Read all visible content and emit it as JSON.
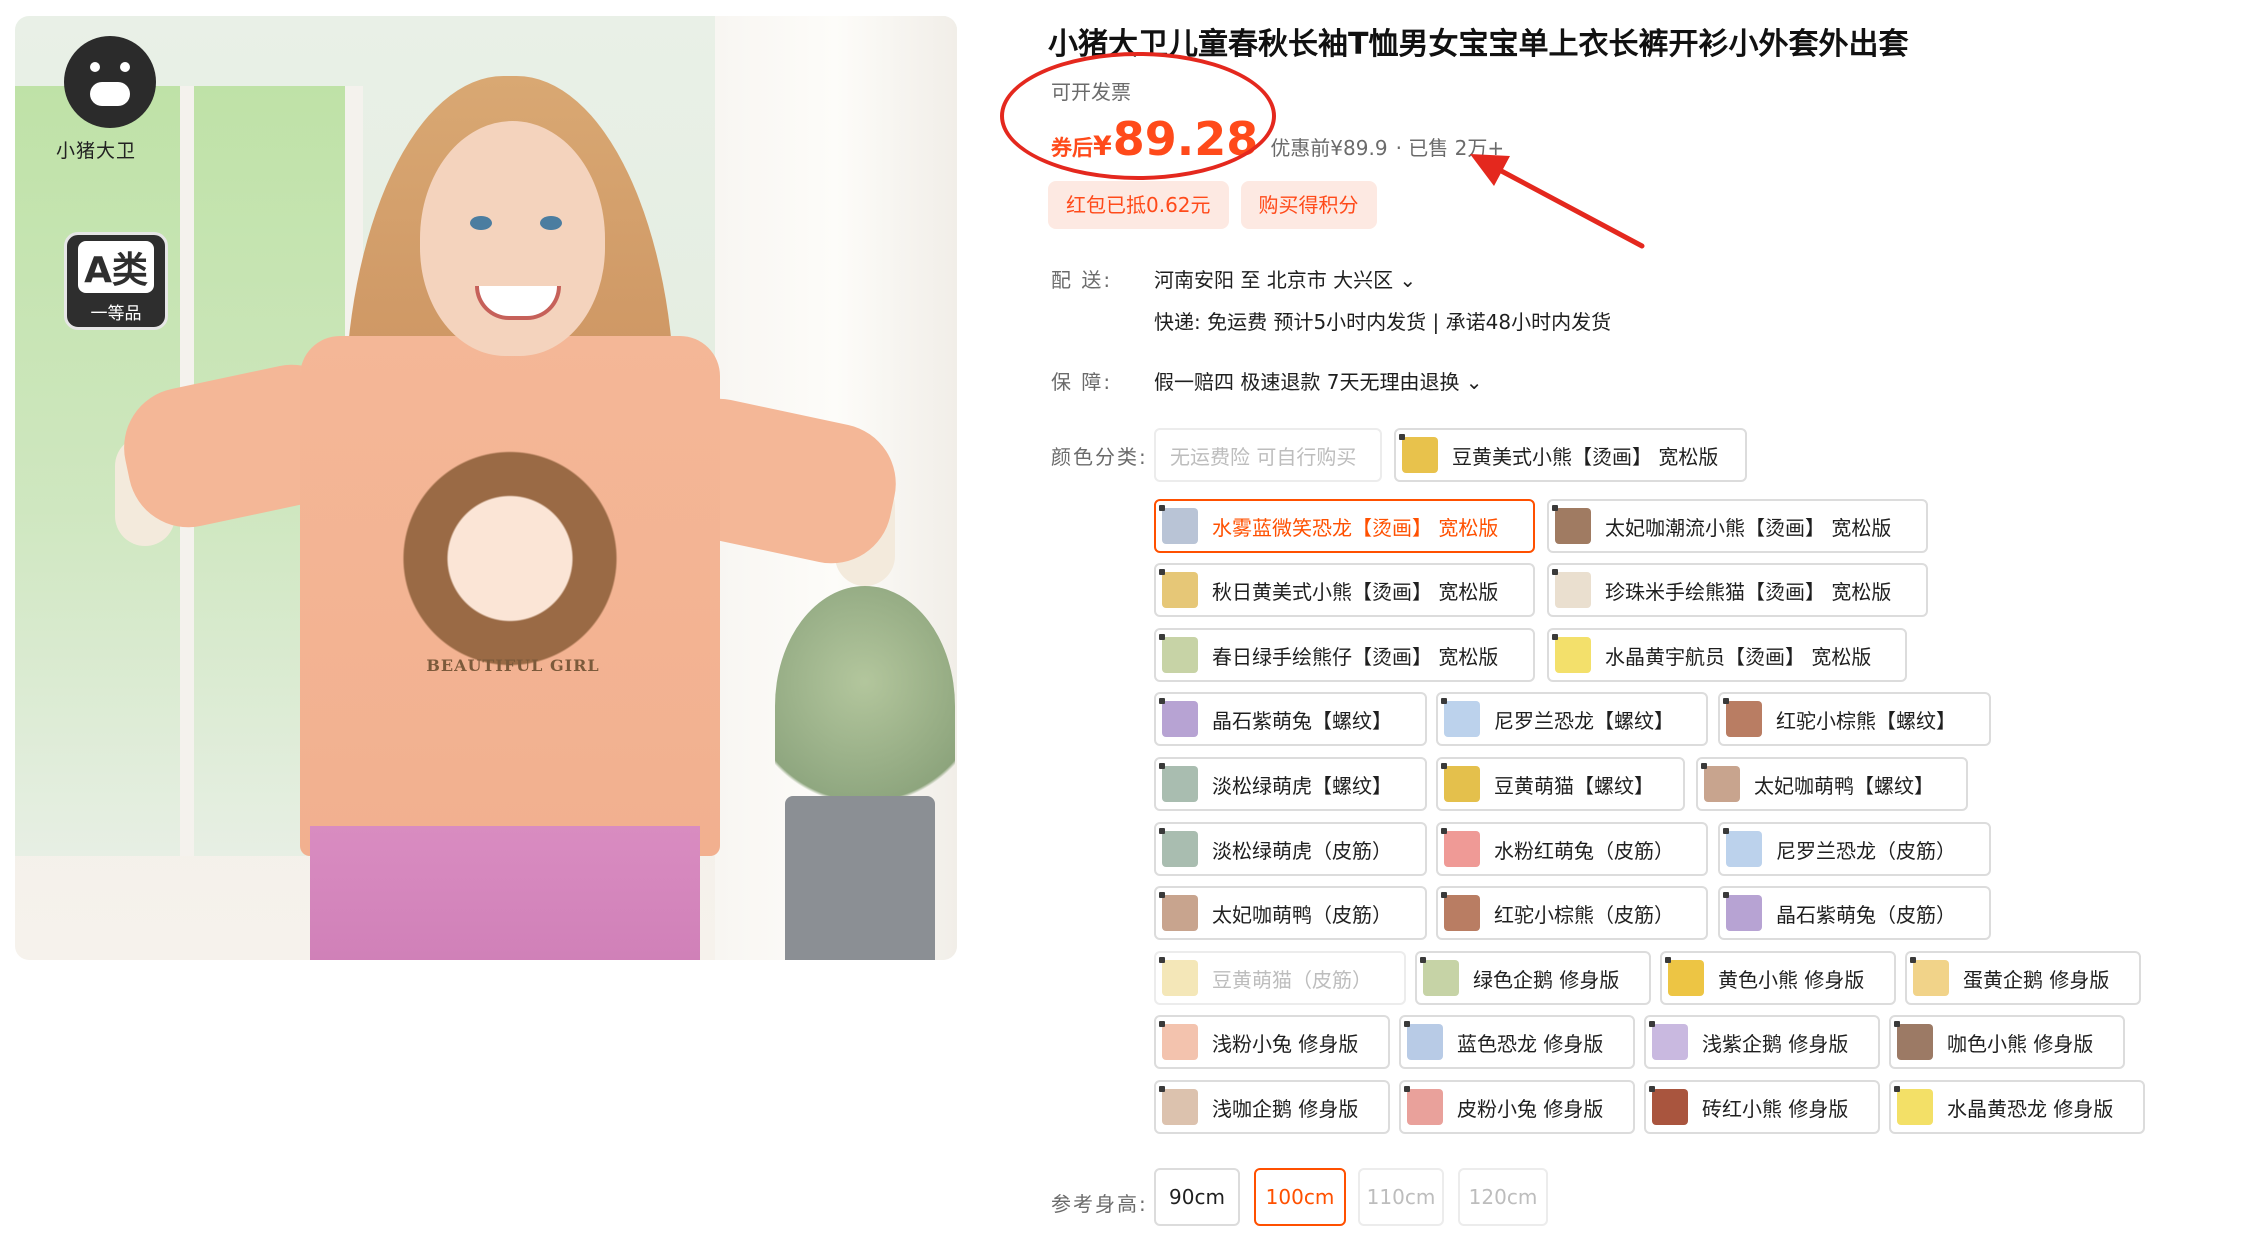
{
  "product": {
    "title": "小猪大卫儿童春秋长袖T恤男女宝宝单上衣长裤开衫小外套外出套",
    "invoice": "可开发票",
    "price_prefix": "券后",
    "currency": "¥",
    "price": "89.28",
    "original_price": "优惠前¥89.9",
    "sold": "· 已售 2万+"
  },
  "image": {
    "brand": "小猪大卫",
    "badge_main": "A类",
    "badge_sub": "一等品",
    "print_text": "BEAUTIFUL GIRL"
  },
  "promo_tags": [
    "红包已抵0.62元",
    "购买得积分"
  ],
  "shipping": {
    "label": "配    送:",
    "from": "河南安阳  至  北京市 大兴区 ⌄",
    "note": "快递: 免运费   预计5小时内发货 | 承诺48小时内发货"
  },
  "guarantee": {
    "label": "保    障:",
    "text": "假一赔四  极速退款  7天无理由退换 ⌄"
  },
  "color": {
    "label": "颜色分类:",
    "options": [
      {
        "text": "无运费险 可自行购买",
        "state": "disabled",
        "swatch": ""
      },
      {
        "text": "豆黄美式小熊【烫画】 宽松版",
        "state": "normal",
        "swatch": "#e8c24c"
      },
      {
        "text": "水雾蓝微笑恐龙【烫画】 宽松版",
        "state": "selected",
        "swatch": "#b9c4d6"
      },
      {
        "text": "太妃咖潮流小熊【烫画】 宽松版",
        "state": "normal",
        "swatch": "#a07b62"
      },
      {
        "text": "秋日黄美式小熊【烫画】 宽松版",
        "state": "normal",
        "swatch": "#e6c777"
      },
      {
        "text": "珍珠米手绘熊猫【烫画】 宽松版",
        "state": "normal",
        "swatch": "#eadfcf"
      },
      {
        "text": "春日绿手绘熊仔【烫画】 宽松版",
        "state": "normal",
        "swatch": "#c7d3a6"
      },
      {
        "text": "水晶黄宇航员【烫画】 宽松版",
        "state": "normal",
        "swatch": "#f3e06b"
      },
      {
        "text": "晶石紫萌兔【螺纹】",
        "state": "normal",
        "swatch": "#b7a3d3"
      },
      {
        "text": "尼罗兰恐龙【螺纹】",
        "state": "normal",
        "swatch": "#bcd2ec"
      },
      {
        "text": "红驼小棕熊【螺纹】",
        "state": "normal",
        "swatch": "#b97d63"
      },
      {
        "text": "淡松绿萌虎【螺纹】",
        "state": "normal",
        "swatch": "#a9bdb0"
      },
      {
        "text": "豆黄萌猫【螺纹】",
        "state": "normal",
        "swatch": "#e4c04c"
      },
      {
        "text": "太妃咖萌鸭【螺纹】",
        "state": "normal",
        "swatch": "#c8a48e"
      },
      {
        "text": "淡松绿萌虎（皮筋）",
        "state": "normal",
        "swatch": "#a9bdb0"
      },
      {
        "text": "水粉红萌兔（皮筋）",
        "state": "normal",
        "swatch": "#ef9a96"
      },
      {
        "text": "尼罗兰恐龙（皮筋）",
        "state": "normal",
        "swatch": "#bcd2ec"
      },
      {
        "text": "太妃咖萌鸭（皮筋）",
        "state": "normal",
        "swatch": "#c8a48e"
      },
      {
        "text": "红驼小棕熊（皮筋）",
        "state": "normal",
        "swatch": "#b97d63"
      },
      {
        "text": "晶石紫萌兔（皮筋）",
        "state": "normal",
        "swatch": "#b7a3d3"
      },
      {
        "text": "豆黄萌猫（皮筋）",
        "state": "disabled",
        "swatch": "#f4e7b8"
      },
      {
        "text": "绿色企鹅 修身版",
        "state": "normal",
        "swatch": "#c6d3a6"
      },
      {
        "text": "黄色小熊 修身版",
        "state": "normal",
        "swatch": "#edc544"
      },
      {
        "text": "蛋黄企鹅 修身版",
        "state": "normal",
        "swatch": "#f1d389"
      },
      {
        "text": "浅粉小兔 修身版",
        "state": "normal",
        "swatch": "#f3c3ae"
      },
      {
        "text": "蓝色恐龙 修身版",
        "state": "normal",
        "swatch": "#b8cbe6"
      },
      {
        "text": "浅紫企鹅 修身版",
        "state": "normal",
        "swatch": "#c9b9e0"
      },
      {
        "text": "咖色小熊 修身版",
        "state": "normal",
        "swatch": "#9c7a65"
      },
      {
        "text": "浅咖企鹅 修身版",
        "state": "normal",
        "swatch": "#dcc2ae"
      },
      {
        "text": "皮粉小兔 修身版",
        "state": "normal",
        "swatch": "#e9a19b"
      },
      {
        "text": "砖红小熊 修身版",
        "state": "normal",
        "swatch": "#a9553e"
      },
      {
        "text": "水晶黄恐龙 修身版",
        "state": "normal",
        "swatch": "#f3e067"
      }
    ]
  },
  "size": {
    "label": "参考身高:",
    "options": [
      {
        "text": "90cm",
        "state": "normal"
      },
      {
        "text": "100cm",
        "state": "selected"
      },
      {
        "text": "110cm",
        "state": "disabled"
      },
      {
        "text": "120cm",
        "state": "disabled"
      }
    ]
  },
  "colors": {
    "accent": "#ff5000",
    "price": "#ff4a1a",
    "annotation": "#e4281e"
  }
}
